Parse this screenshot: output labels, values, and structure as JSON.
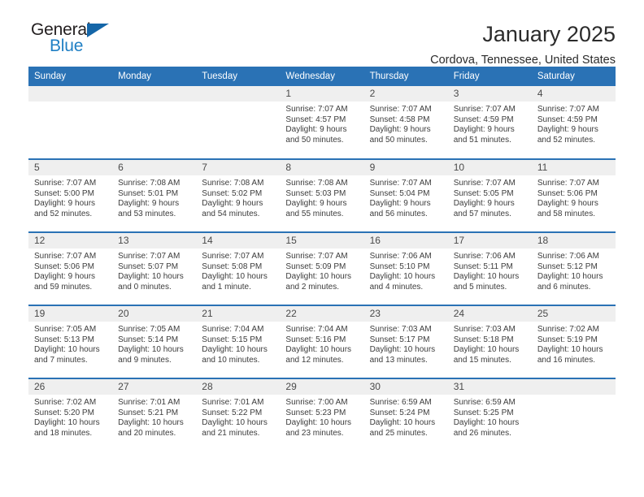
{
  "brand": {
    "name_part1": "General",
    "name_part2": "Blue",
    "logo_icon": "triangle-logo-icon"
  },
  "header": {
    "title": "January 2025",
    "subtitle": "Cordova, Tennessee, United States"
  },
  "colors": {
    "header_blue": "#2a72b5",
    "daynum_gray": "#efefef",
    "brand_blue": "#1f7fc4",
    "logo_triangle_blue": "#1566a8",
    "text": "#3c3c3c"
  },
  "weekday_headers": [
    "Sunday",
    "Monday",
    "Tuesday",
    "Wednesday",
    "Thursday",
    "Friday",
    "Saturday"
  ],
  "labels": {
    "sunrise": "Sunrise:",
    "sunset": "Sunset:",
    "daylight": "Daylight:"
  },
  "weeks": [
    [
      {
        "day": "",
        "empty": true
      },
      {
        "day": "",
        "empty": true
      },
      {
        "day": "",
        "empty": true
      },
      {
        "day": "1",
        "sunrise": "Sunrise: 7:07 AM",
        "sunset": "Sunset: 4:57 PM",
        "daylight1": "Daylight: 9 hours",
        "daylight2": "and 50 minutes."
      },
      {
        "day": "2",
        "sunrise": "Sunrise: 7:07 AM",
        "sunset": "Sunset: 4:58 PM",
        "daylight1": "Daylight: 9 hours",
        "daylight2": "and 50 minutes."
      },
      {
        "day": "3",
        "sunrise": "Sunrise: 7:07 AM",
        "sunset": "Sunset: 4:59 PM",
        "daylight1": "Daylight: 9 hours",
        "daylight2": "and 51 minutes."
      },
      {
        "day": "4",
        "sunrise": "Sunrise: 7:07 AM",
        "sunset": "Sunset: 4:59 PM",
        "daylight1": "Daylight: 9 hours",
        "daylight2": "and 52 minutes."
      }
    ],
    [
      {
        "day": "5",
        "sunrise": "Sunrise: 7:07 AM",
        "sunset": "Sunset: 5:00 PM",
        "daylight1": "Daylight: 9 hours",
        "daylight2": "and 52 minutes."
      },
      {
        "day": "6",
        "sunrise": "Sunrise: 7:08 AM",
        "sunset": "Sunset: 5:01 PM",
        "daylight1": "Daylight: 9 hours",
        "daylight2": "and 53 minutes."
      },
      {
        "day": "7",
        "sunrise": "Sunrise: 7:08 AM",
        "sunset": "Sunset: 5:02 PM",
        "daylight1": "Daylight: 9 hours",
        "daylight2": "and 54 minutes."
      },
      {
        "day": "8",
        "sunrise": "Sunrise: 7:08 AM",
        "sunset": "Sunset: 5:03 PM",
        "daylight1": "Daylight: 9 hours",
        "daylight2": "and 55 minutes."
      },
      {
        "day": "9",
        "sunrise": "Sunrise: 7:07 AM",
        "sunset": "Sunset: 5:04 PM",
        "daylight1": "Daylight: 9 hours",
        "daylight2": "and 56 minutes."
      },
      {
        "day": "10",
        "sunrise": "Sunrise: 7:07 AM",
        "sunset": "Sunset: 5:05 PM",
        "daylight1": "Daylight: 9 hours",
        "daylight2": "and 57 minutes."
      },
      {
        "day": "11",
        "sunrise": "Sunrise: 7:07 AM",
        "sunset": "Sunset: 5:06 PM",
        "daylight1": "Daylight: 9 hours",
        "daylight2": "and 58 minutes."
      }
    ],
    [
      {
        "day": "12",
        "sunrise": "Sunrise: 7:07 AM",
        "sunset": "Sunset: 5:06 PM",
        "daylight1": "Daylight: 9 hours",
        "daylight2": "and 59 minutes."
      },
      {
        "day": "13",
        "sunrise": "Sunrise: 7:07 AM",
        "sunset": "Sunset: 5:07 PM",
        "daylight1": "Daylight: 10 hours",
        "daylight2": "and 0 minutes."
      },
      {
        "day": "14",
        "sunrise": "Sunrise: 7:07 AM",
        "sunset": "Sunset: 5:08 PM",
        "daylight1": "Daylight: 10 hours",
        "daylight2": "and 1 minute."
      },
      {
        "day": "15",
        "sunrise": "Sunrise: 7:07 AM",
        "sunset": "Sunset: 5:09 PM",
        "daylight1": "Daylight: 10 hours",
        "daylight2": "and 2 minutes."
      },
      {
        "day": "16",
        "sunrise": "Sunrise: 7:06 AM",
        "sunset": "Sunset: 5:10 PM",
        "daylight1": "Daylight: 10 hours",
        "daylight2": "and 4 minutes."
      },
      {
        "day": "17",
        "sunrise": "Sunrise: 7:06 AM",
        "sunset": "Sunset: 5:11 PM",
        "daylight1": "Daylight: 10 hours",
        "daylight2": "and 5 minutes."
      },
      {
        "day": "18",
        "sunrise": "Sunrise: 7:06 AM",
        "sunset": "Sunset: 5:12 PM",
        "daylight1": "Daylight: 10 hours",
        "daylight2": "and 6 minutes."
      }
    ],
    [
      {
        "day": "19",
        "sunrise": "Sunrise: 7:05 AM",
        "sunset": "Sunset: 5:13 PM",
        "daylight1": "Daylight: 10 hours",
        "daylight2": "and 7 minutes."
      },
      {
        "day": "20",
        "sunrise": "Sunrise: 7:05 AM",
        "sunset": "Sunset: 5:14 PM",
        "daylight1": "Daylight: 10 hours",
        "daylight2": "and 9 minutes."
      },
      {
        "day": "21",
        "sunrise": "Sunrise: 7:04 AM",
        "sunset": "Sunset: 5:15 PM",
        "daylight1": "Daylight: 10 hours",
        "daylight2": "and 10 minutes."
      },
      {
        "day": "22",
        "sunrise": "Sunrise: 7:04 AM",
        "sunset": "Sunset: 5:16 PM",
        "daylight1": "Daylight: 10 hours",
        "daylight2": "and 12 minutes."
      },
      {
        "day": "23",
        "sunrise": "Sunrise: 7:03 AM",
        "sunset": "Sunset: 5:17 PM",
        "daylight1": "Daylight: 10 hours",
        "daylight2": "and 13 minutes."
      },
      {
        "day": "24",
        "sunrise": "Sunrise: 7:03 AM",
        "sunset": "Sunset: 5:18 PM",
        "daylight1": "Daylight: 10 hours",
        "daylight2": "and 15 minutes."
      },
      {
        "day": "25",
        "sunrise": "Sunrise: 7:02 AM",
        "sunset": "Sunset: 5:19 PM",
        "daylight1": "Daylight: 10 hours",
        "daylight2": "and 16 minutes."
      }
    ],
    [
      {
        "day": "26",
        "sunrise": "Sunrise: 7:02 AM",
        "sunset": "Sunset: 5:20 PM",
        "daylight1": "Daylight: 10 hours",
        "daylight2": "and 18 minutes."
      },
      {
        "day": "27",
        "sunrise": "Sunrise: 7:01 AM",
        "sunset": "Sunset: 5:21 PM",
        "daylight1": "Daylight: 10 hours",
        "daylight2": "and 20 minutes."
      },
      {
        "day": "28",
        "sunrise": "Sunrise: 7:01 AM",
        "sunset": "Sunset: 5:22 PM",
        "daylight1": "Daylight: 10 hours",
        "daylight2": "and 21 minutes."
      },
      {
        "day": "29",
        "sunrise": "Sunrise: 7:00 AM",
        "sunset": "Sunset: 5:23 PM",
        "daylight1": "Daylight: 10 hours",
        "daylight2": "and 23 minutes."
      },
      {
        "day": "30",
        "sunrise": "Sunrise: 6:59 AM",
        "sunset": "Sunset: 5:24 PM",
        "daylight1": "Daylight: 10 hours",
        "daylight2": "and 25 minutes."
      },
      {
        "day": "31",
        "sunrise": "Sunrise: 6:59 AM",
        "sunset": "Sunset: 5:25 PM",
        "daylight1": "Daylight: 10 hours",
        "daylight2": "and 26 minutes."
      },
      {
        "day": "",
        "empty": true
      }
    ]
  ]
}
